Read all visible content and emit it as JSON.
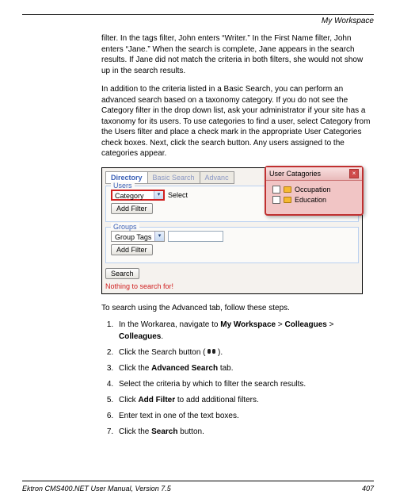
{
  "header": {
    "section_title": "My Workspace"
  },
  "paragraphs": {
    "p1": "filter. In the tags filter, John enters “Writer.” In the First Name filter, John enters “Jane.” When the search is complete, Jane appears in the search results. If Jane did not match the criteria in both filters, she would not show up in the search results.",
    "p2": "In addition to the criteria listed in a Basic Search, you can perform an advanced search based on a taxonomy category. If you do not see the Category filter in the drop down list, ask your administrator if your site has a taxonomy for its users. To use categories to find a user, select Category from the Users filter and place a check mark in the appropriate User Categories check boxes. Next, click the search button. Any users assigned to the categories appear."
  },
  "ui": {
    "tabs": {
      "directory": "Directory",
      "basic": "Basic Search",
      "advanced": "Advanc"
    },
    "users": {
      "legend": "Users",
      "selected": "Category",
      "select_label": "Select",
      "add_filter": "Add Filter"
    },
    "groups": {
      "legend": "Groups",
      "selected": "Group Tags",
      "add_filter": "Add Filter"
    },
    "search_btn": "Search",
    "status": "Nothing to search for!",
    "popup": {
      "title": "User Catagories",
      "items": [
        "Occupation",
        "Education"
      ]
    }
  },
  "steps_intro": "To search using the Advanced tab, follow these steps.",
  "steps": {
    "s1a": "In the Workarea, navigate to ",
    "s1b": "My Workspace",
    "s1c": " > ",
    "s1d": "Colleagues",
    "s1e": " > ",
    "s1f": "Colleagues",
    "s1g": ".",
    "s2a": "Click the Search button ( ",
    "s2b": " ).",
    "s3a": "Click the ",
    "s3b": "Advanced Search",
    "s3c": " tab.",
    "s4": "Select the criteria by which to filter the search results.",
    "s5a": "Click ",
    "s5b": "Add Filter",
    "s5c": " to add additional filters.",
    "s6": "Enter text in one of the text boxes.",
    "s7a": "Click the ",
    "s7b": "Search",
    "s7c": " button."
  },
  "footer": {
    "left": "Ektron CMS400.NET User Manual, Version 7.5",
    "right": "407"
  }
}
